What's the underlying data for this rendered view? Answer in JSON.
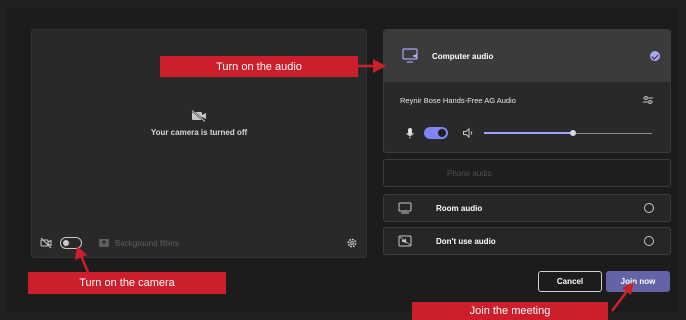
{
  "preview": {
    "camera_off_text": "Your camera is turned off",
    "background_filters_label": "Background filters"
  },
  "audio": {
    "computer_audio_label": "Computer audio",
    "device_name": "Reynir Bose Hands-Free AG Audio",
    "speaker_volume": 0.53,
    "phone_audio_label": "Phone audio",
    "room_audio_label": "Room audio",
    "dont_use_audio_label": "Don't use audio"
  },
  "buttons": {
    "cancel_label": "Cancel",
    "join_label": "Join now"
  },
  "annotations": {
    "audio_callout": "Turn on the audio",
    "camera_callout": "Turn on the camera",
    "join_callout": "Join the meeting"
  },
  "colors": {
    "accent": "#6264a7",
    "toggle_on": "#7f85f5",
    "callout_red": "#cc1f2b"
  }
}
